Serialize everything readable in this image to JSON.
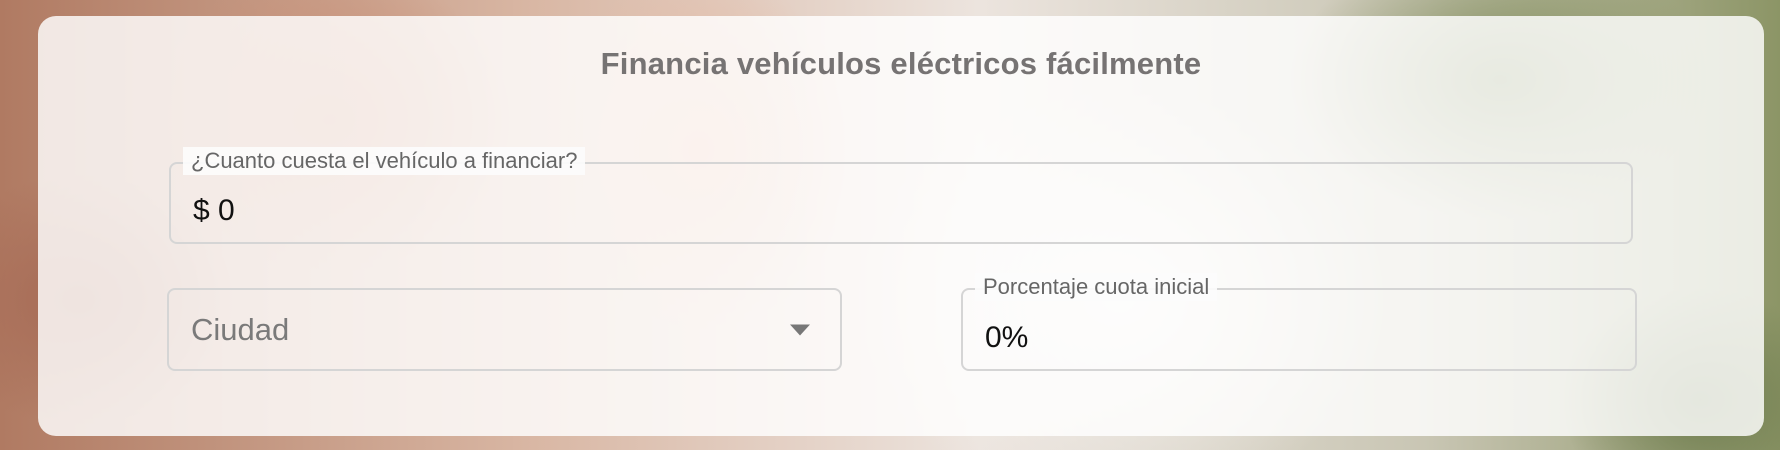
{
  "title": "Financia vehículos eléctricos fácilmente",
  "price_field": {
    "label": "¿Cuanto cuesta el vehículo a financiar?",
    "value": "$ 0"
  },
  "city_select": {
    "placeholder": "Ciudad",
    "icon": "chevron-down-icon"
  },
  "down_payment_field": {
    "label": "Porcentaje cuota inicial",
    "value": "0%"
  }
}
